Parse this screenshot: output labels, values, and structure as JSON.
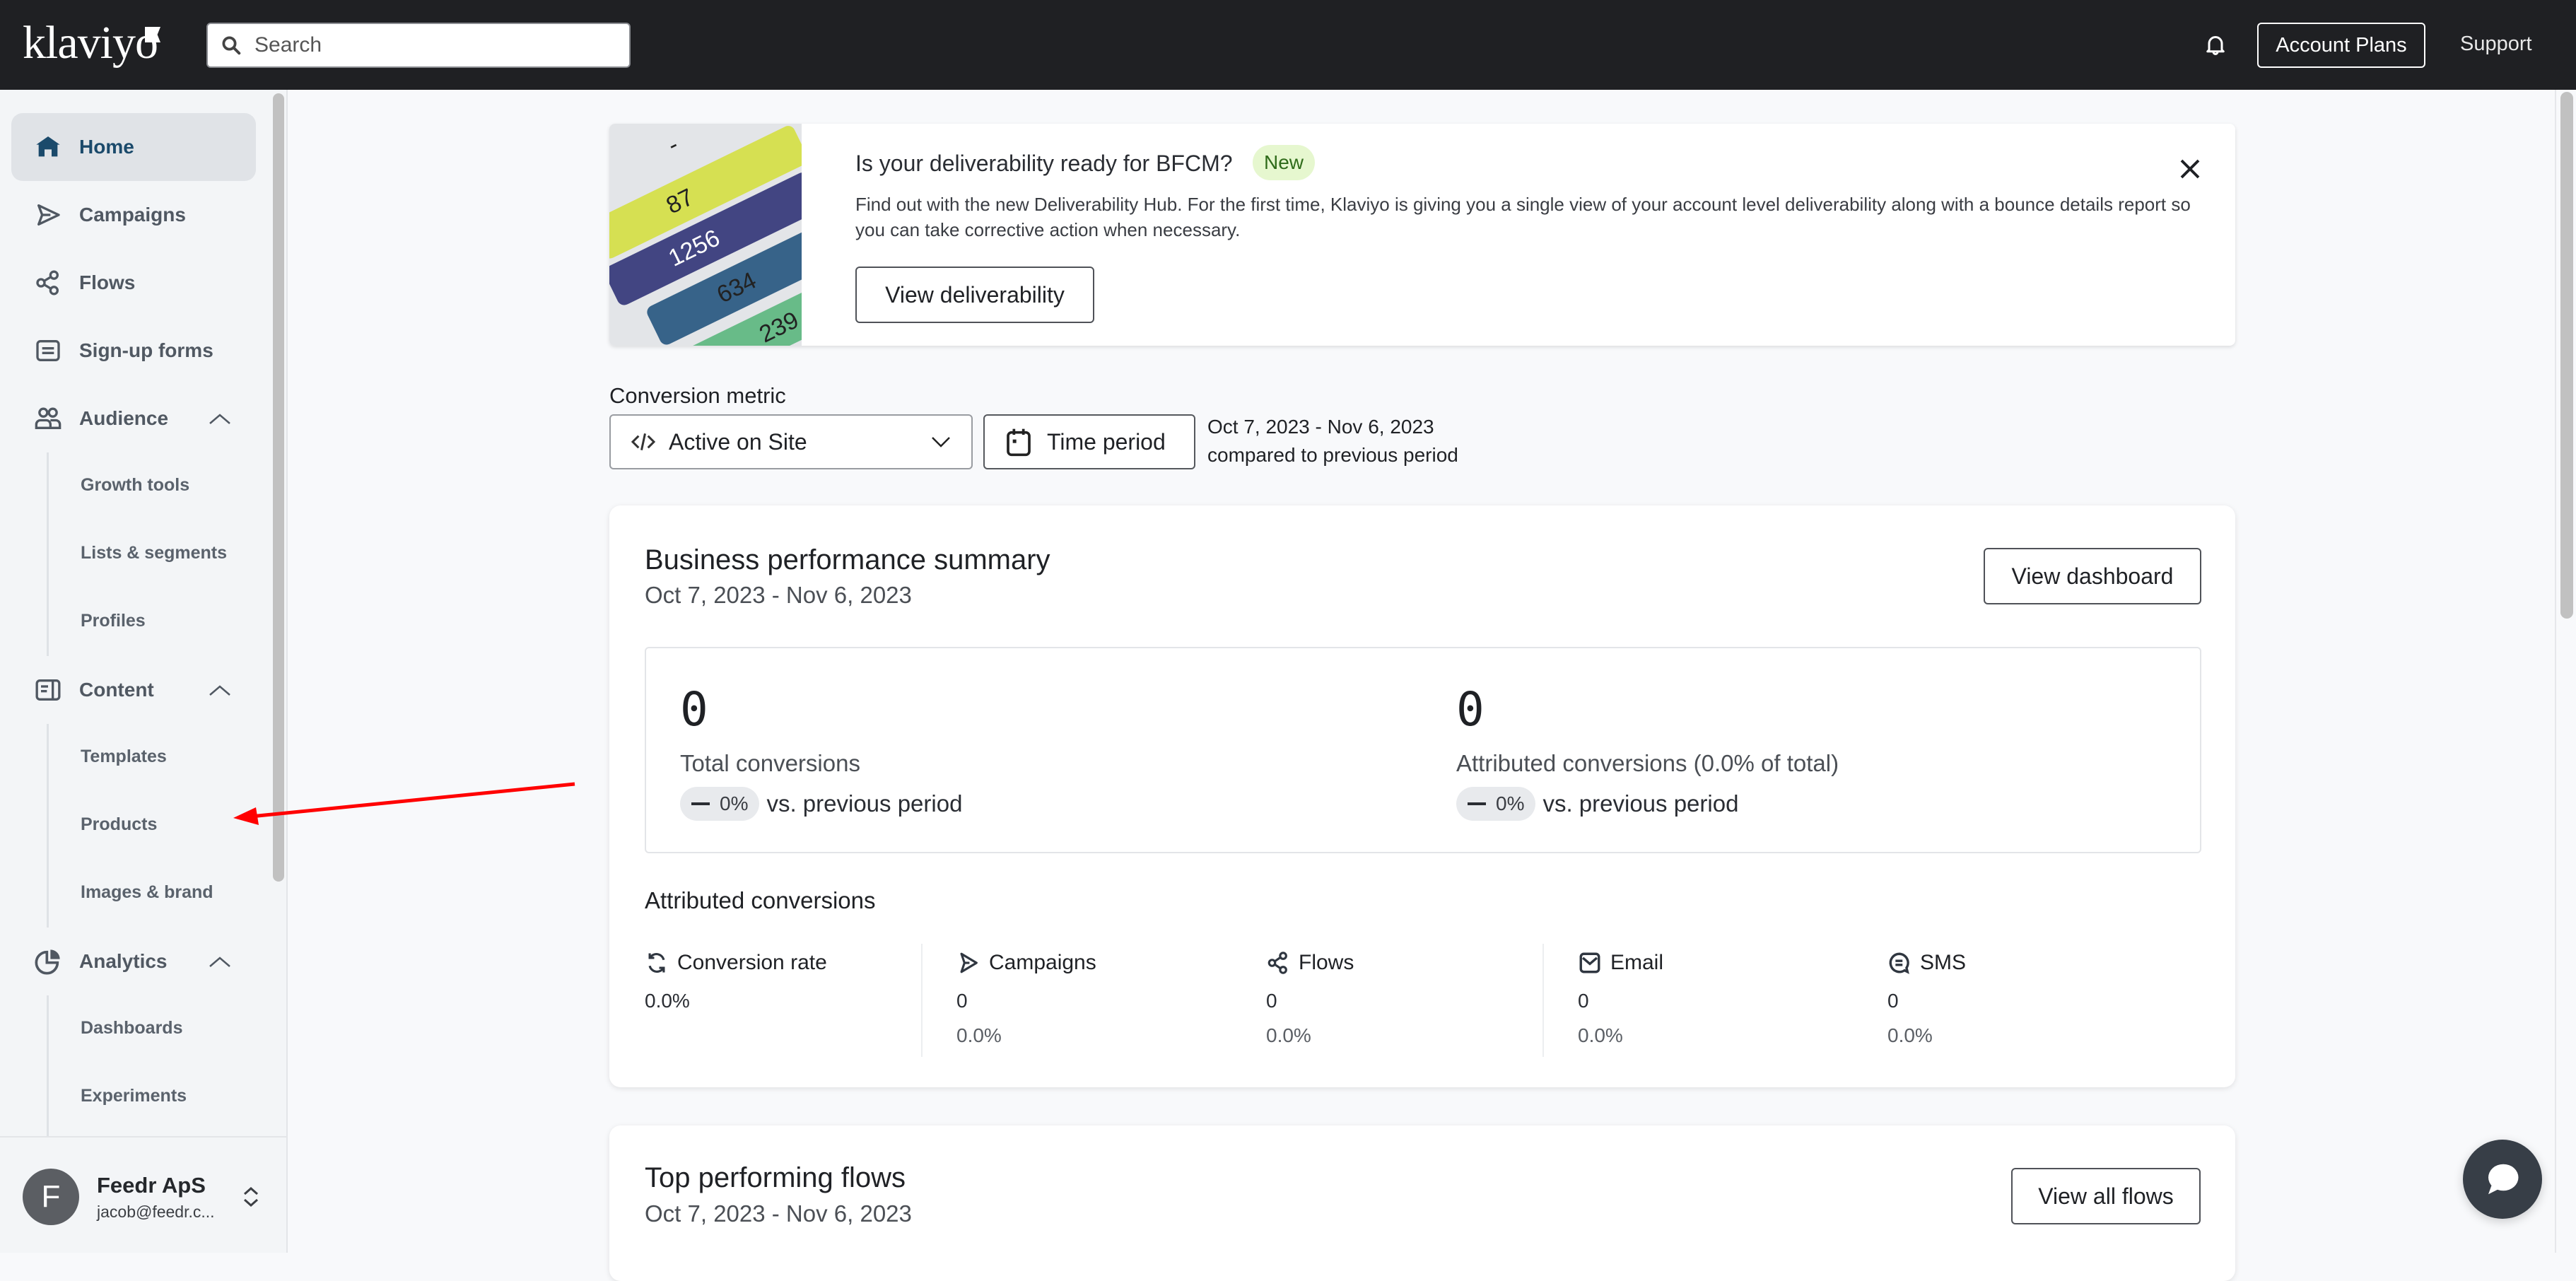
{
  "topbar": {
    "logo_text": "klaviyo",
    "search_placeholder": "Search",
    "account_plans_label": "Account Plans",
    "support_label": "Support"
  },
  "sidebar": {
    "items": [
      {
        "label": "Home",
        "icon": "home-icon",
        "active": true
      },
      {
        "label": "Campaigns",
        "icon": "send-icon"
      },
      {
        "label": "Flows",
        "icon": "flows-icon"
      },
      {
        "label": "Sign-up forms",
        "icon": "form-icon"
      },
      {
        "label": "Audience",
        "icon": "people-icon",
        "expanded": true,
        "children": [
          "Growth tools",
          "Lists & segments",
          "Profiles"
        ]
      },
      {
        "label": "Content",
        "icon": "content-icon",
        "expanded": true,
        "children": [
          "Templates",
          "Products",
          "Images & brand"
        ]
      },
      {
        "label": "Analytics",
        "icon": "analytics-icon",
        "expanded": true,
        "children": [
          "Dashboards",
          "Experiments"
        ]
      }
    ],
    "account": {
      "avatar_letter": "F",
      "name": "Feedr ApS",
      "email": "jacob@feedr.c..."
    }
  },
  "banner": {
    "title": "Is your deliverability ready for BFCM?",
    "badge": "New",
    "body": "Find out with the new Deliverability Hub. For the first time, Klaviyo is giving you a single view of your account level deliverability along with a bounce details report so you can take corrective action when necessary.",
    "button_label": "View deliverability",
    "thumbnail_values": [
      "-",
      "87",
      "1256",
      "634",
      "239"
    ]
  },
  "conversion_metric": {
    "label": "Conversion metric",
    "selected": "Active on Site",
    "time_button_label": "Time period",
    "range": "Oct 7, 2023 - Nov 6, 2023",
    "comparison": "compared to previous period"
  },
  "business_summary": {
    "title": "Business performance summary",
    "range": "Oct 7, 2023 - Nov 6, 2023",
    "view_button": "View dashboard",
    "kpis": [
      {
        "value": "0",
        "label": "Total conversions",
        "delta": "0%",
        "vs": "vs. previous period"
      },
      {
        "value": "0",
        "label": "Attributed conversions (0.0% of total)",
        "delta": "0%",
        "vs": "vs. previous period"
      }
    ],
    "attributed_title": "Attributed conversions",
    "attributed": [
      {
        "label": "Conversion rate",
        "icon": "refresh-icon",
        "value": "0.0%",
        "pct": ""
      },
      {
        "label": "Campaigns",
        "icon": "send-icon",
        "value": "0",
        "pct": "0.0%"
      },
      {
        "label": "Flows",
        "icon": "flows-icon",
        "value": "0",
        "pct": "0.0%"
      },
      {
        "label": "Email",
        "icon": "mail-icon",
        "value": "0",
        "pct": "0.0%"
      },
      {
        "label": "SMS",
        "icon": "sms-icon",
        "value": "0",
        "pct": "0.0%"
      }
    ]
  },
  "top_flows": {
    "title": "Top performing flows",
    "range": "Oct 7, 2023 - Nov 6, 2023",
    "view_button": "View all flows"
  },
  "colors": {
    "topbar": "#1f2023",
    "active_nav_text": "#1b4a6b",
    "badge_bg": "#e6f7cf",
    "badge_text": "#2f6b1a",
    "annotation_arrow": "#ff0000",
    "chat_bubble": "#373e47"
  }
}
